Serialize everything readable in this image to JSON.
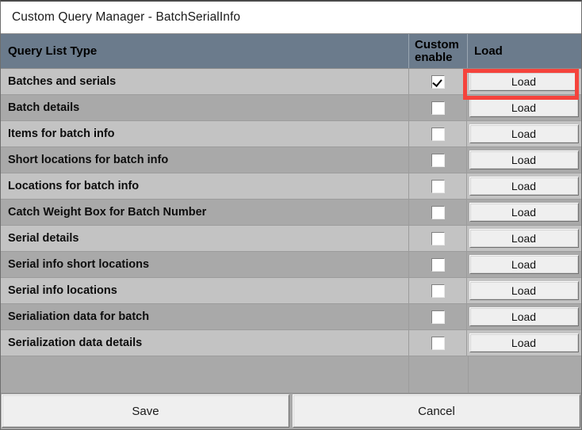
{
  "window": {
    "title": "Custom Query Manager - BatchSerialInfo"
  },
  "grid": {
    "columns": [
      {
        "key": "name",
        "label": "Query List Type"
      },
      {
        "key": "check",
        "label": "Custom\nenable",
        "line1": "Custom",
        "line2": "enable"
      },
      {
        "key": "load",
        "label": "Load"
      }
    ],
    "rows": [
      {
        "name": "Batches and serials",
        "checked": true,
        "load_label": "Load",
        "highlighted": true
      },
      {
        "name": "Batch details",
        "checked": false,
        "load_label": "Load",
        "highlighted": false
      },
      {
        "name": "Items for batch info",
        "checked": false,
        "load_label": "Load",
        "highlighted": false
      },
      {
        "name": "Short locations for batch info",
        "checked": false,
        "load_label": "Load",
        "highlighted": false
      },
      {
        "name": "Locations for batch info",
        "checked": false,
        "load_label": "Load",
        "highlighted": false
      },
      {
        "name": "Catch Weight Box for Batch Number",
        "checked": false,
        "load_label": "Load",
        "highlighted": false
      },
      {
        "name": "Serial details",
        "checked": false,
        "load_label": "Load",
        "highlighted": false
      },
      {
        "name": "Serial info short locations",
        "checked": false,
        "load_label": "Load",
        "highlighted": false
      },
      {
        "name": "Serial info locations",
        "checked": false,
        "load_label": "Load",
        "highlighted": false
      },
      {
        "name": "Serialiation data for batch",
        "checked": false,
        "load_label": "Load",
        "highlighted": false
      },
      {
        "name": "Serialization data details",
        "checked": false,
        "load_label": "Load",
        "highlighted": false
      }
    ]
  },
  "footer": {
    "save_label": "Save",
    "cancel_label": "Cancel"
  },
  "colors": {
    "header_bg": "#6b7b8c",
    "row_light": "#c3c3c3",
    "row_dark": "#a9a9a9",
    "button_face": "#efefef",
    "highlight": "#f5433c",
    "titlebar_bg": "#ffffff"
  }
}
